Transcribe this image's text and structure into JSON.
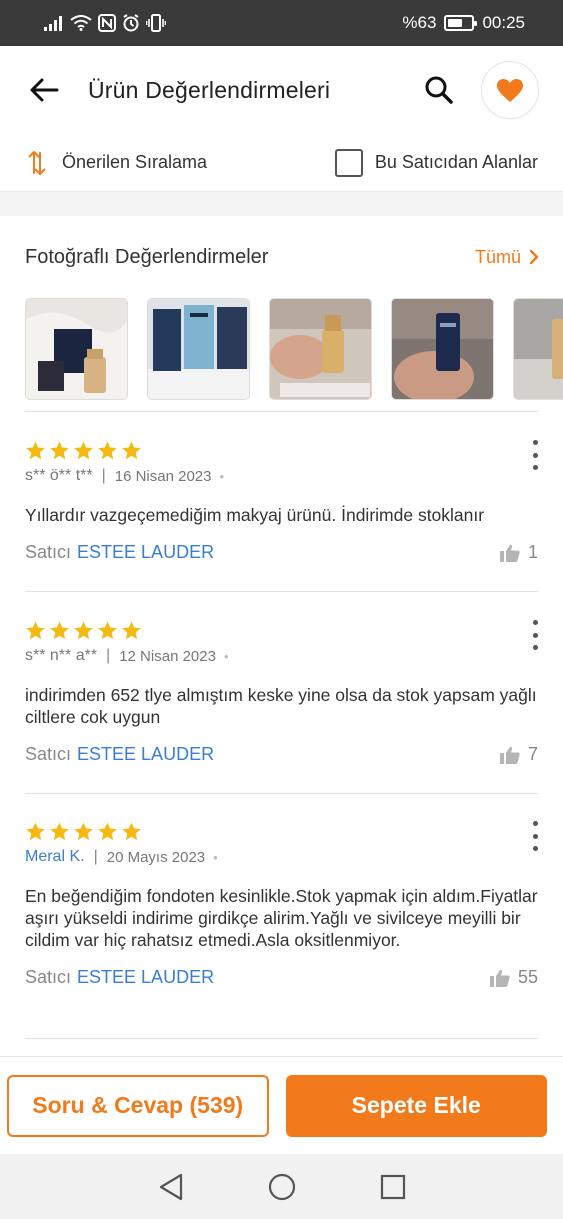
{
  "status_bar": {
    "battery_text": "%63",
    "battery_level": 0.63,
    "time": "00:25",
    "icons": [
      "signal-icon",
      "wifi-icon",
      "nfc-icon",
      "alarm-icon",
      "vibrate-icon",
      "battery-icon"
    ]
  },
  "header": {
    "title": "Ürün Değerlendirmeleri",
    "icons": [
      "back-arrow-icon",
      "search-icon",
      "heart-icon"
    ],
    "accent_color": "#f27a1a"
  },
  "filters": {
    "sort_label": "Önerilen Sıralama",
    "seller_filter_label": "Bu Satıcıdan Alanlar",
    "seller_filter_checked": false
  },
  "photo_reviews": {
    "title": "Fotoğraflı Değerlendirmeler",
    "see_all": "Tümü"
  },
  "reviews": [
    {
      "rating": 5,
      "reviewer": "s** ö** t**",
      "date": "16 Nisan 2023",
      "text": "Yıllardır vazgeçemediğim makyaj ürünü. İndirimde stoklanır",
      "seller_prefix": "Satıcı",
      "seller": "ESTEE LAUDER",
      "likes": "1"
    },
    {
      "rating": 5,
      "reviewer": "s** n** a**",
      "date": "12 Nisan 2023",
      "text": "indirimden 652 tlye almıştım keske yine olsa da stok yapsam yağlı ciltlere cok uygun",
      "seller_prefix": "Satıcı",
      "seller": "ESTEE LAUDER",
      "likes": "7"
    },
    {
      "rating": 5,
      "reviewer": "Meral K.",
      "date": "20 Mayıs 2023",
      "text": "En beğendiğim fondoten kesinlikle.Stok yapmak için aldım.Fiyatlar aşırı yükseldi indirime girdikçe alirim.Yağlı ve sivilceye meyilli bir cildim var hiç rahatsız etmedi.Asla oksitlenmiyor.",
      "seller_prefix": "Satıcı",
      "seller": "ESTEE LAUDER",
      "likes": "55"
    }
  ],
  "bottom_bar": {
    "qa_label": "Soru & Cevap (539)",
    "add_to_cart_label": "Sepete Ekle"
  },
  "colors": {
    "accent": "#f27a1a",
    "star": "#f5b914",
    "link": "#3a7dd8"
  }
}
